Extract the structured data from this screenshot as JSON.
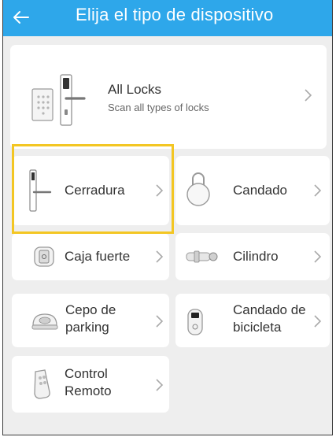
{
  "header": {
    "title": "Elija el tipo de dispositivo",
    "background": "#2ea7ea"
  },
  "all_locks": {
    "title": "All Locks",
    "subtitle": "Scan all types of locks"
  },
  "devices": [
    {
      "label": "Cerradura",
      "icon": "door-lock-handle-icon"
    },
    {
      "label": "Candado",
      "icon": "padlock-icon"
    },
    {
      "label": "Caja fuerte",
      "icon": "safe-icon"
    },
    {
      "label": "Cilindro",
      "icon": "cylinder-lock-icon"
    },
    {
      "label": "Cepo de parking",
      "line1": "Cepo de",
      "line2": "parking",
      "icon": "parking-lock-icon"
    },
    {
      "label": "Candado de bicicleta",
      "line1": "Candado de",
      "line2": "bicicleta",
      "icon": "bike-lock-icon"
    },
    {
      "label": "Control Remoto",
      "line1": "Control",
      "line2": "Remoto",
      "icon": "remote-control-icon"
    }
  ],
  "colors": {
    "highlight": "#f3c623",
    "page_bg": "#eeeeee",
    "card_bg": "#ffffff"
  }
}
